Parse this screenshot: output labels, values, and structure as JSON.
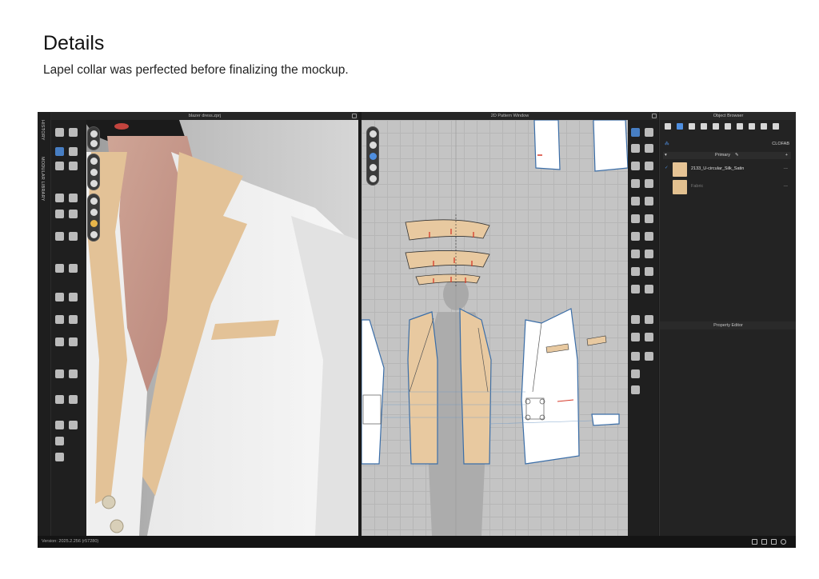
{
  "page": {
    "title": "Details",
    "subtitle": "Lapel collar was perfected before finalizing the mockup."
  },
  "app": {
    "side_tabs": [
      "HISTORY",
      "MODULAR LIBRARY"
    ],
    "view3d_title": "blazer dress.zprj",
    "view2d_title": "2D Pattern Window",
    "status_version": "Version: 2025.2.256 (r57280)"
  },
  "object_browser": {
    "title": "Object Browser",
    "clofab_label": "CLOFAB",
    "group_label": "Primary",
    "fabrics": [
      {
        "name": "2133_U-circular_Silk_Satin",
        "checked": true,
        "swatch_color": "#e8c9a0"
      },
      {
        "name": "Fabric",
        "checked": false,
        "swatch_color": "#e2c08f"
      }
    ],
    "more_label": "···"
  },
  "property_editor": {
    "title": "Property Editor"
  },
  "icons": {
    "view3d_tools": [
      "select-mesh-icon",
      "transform-icon",
      "fold-icon",
      "pin-icon",
      "sewing-icon",
      "tack-icon",
      "avatar-icon",
      "measure-icon"
    ],
    "view2d_tools": [
      "edit-pattern-icon",
      "polygon-icon",
      "rectangle-icon",
      "internal-line-icon",
      "dart-icon",
      "notch-icon",
      "seam-icon",
      "text-icon",
      "annotation-icon"
    ],
    "object_browser_tabs": [
      "list-icon",
      "fabric-icon",
      "pattern-icon",
      "button-icon",
      "buttonhole-icon",
      "topstitch-icon",
      "trim-icon",
      "graphic-icon",
      "material-icon"
    ]
  },
  "colors": {
    "fabric_beige": "#e8c9a0",
    "selected_tool": "#4f8fe0",
    "pattern_outline": "#3b6ea8",
    "sewing_mark": "#d63a2a"
  }
}
